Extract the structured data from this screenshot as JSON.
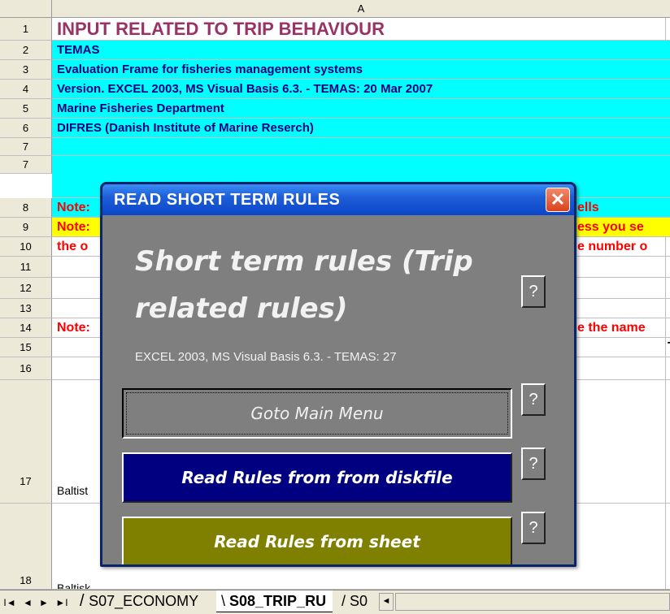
{
  "spreadsheet": {
    "column_header": "A",
    "rows": [
      {
        "num": "1",
        "text": "INPUT RELATED TO TRIP BEHAVIOUR"
      },
      {
        "num": "2",
        "text": "TEMAS"
      },
      {
        "num": "3",
        "text": "Evaluation Frame for fisheries management systems"
      },
      {
        "num": "4",
        "text": "Version. EXCEL 2003, MS Visual Basis 6.3. - TEMAS: 20 Mar 2007"
      },
      {
        "num": "5",
        "text": "Marine Fisheries Department"
      },
      {
        "num": "6",
        "text": "DIFRES (Danish Institute of Marine Reserch)"
      },
      {
        "num": "7",
        "text": ""
      },
      {
        "num": "8",
        "text": "Note:",
        "text_right": "ells"
      },
      {
        "num": "9",
        "text": "Note:",
        "text_right": "ess you se"
      },
      {
        "num": "10",
        "text": "the o",
        "text_right": "e number o"
      },
      {
        "num": "11",
        "text": ""
      },
      {
        "num": "12",
        "text": ""
      },
      {
        "num": "13",
        "text": ""
      },
      {
        "num": "14",
        "text": "Note:",
        "text_right": "e the name"
      },
      {
        "num": "15",
        "text": "",
        "text_right": "Ta"
      },
      {
        "num": "16",
        "text": ""
      },
      {
        "num": "17",
        "text": "Baltist"
      },
      {
        "num": "18",
        "text": "Baltisk"
      }
    ]
  },
  "sheet_tabs": {
    "nav_first": "I◄",
    "nav_prev": "◄",
    "nav_next": "►",
    "nav_last": "►I",
    "tabs": [
      {
        "label": "S07_ECONOMY",
        "active": false
      },
      {
        "label": "S08_TRIP_RU",
        "active": true
      },
      {
        "label": "S0",
        "active": false
      }
    ],
    "scroll_left": "◄"
  },
  "dialog": {
    "title": "READ  SHORT TERM  RULES",
    "close_glyph": "✕",
    "heading": "Short term rules (Trip related rules)",
    "version": "EXCEL 2003, MS Visual Basis 6.3. - TEMAS: 27",
    "help_glyph": "?",
    "buttons": {
      "goto_main": "Goto Main Menu",
      "read_disk": "Read  Rules  from from diskfile",
      "read_sheet": "Read  Rules  from sheet"
    }
  },
  "colors": {
    "cyan": "#00ffff",
    "yellow": "#ffff00",
    "title_purple": "#993366",
    "navy_text": "#000080",
    "red_text": "#ff0000",
    "dialog_gray": "#7f7f7f",
    "btn_navy": "#000080",
    "btn_olive": "#808000"
  }
}
